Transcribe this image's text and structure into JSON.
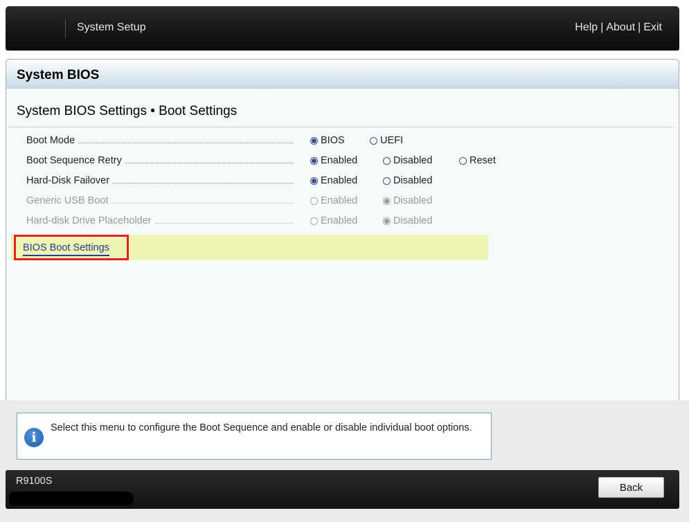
{
  "header": {
    "title": "System Setup",
    "links": [
      "Help",
      "About",
      "Exit"
    ],
    "separator": "|"
  },
  "panel": {
    "title": "System BIOS",
    "breadcrumb": "System BIOS Settings • Boot Settings"
  },
  "settings": [
    {
      "label": "Boot Mode",
      "enabled": true,
      "options": [
        {
          "label": "BIOS",
          "selected": true
        },
        {
          "label": "UEFI",
          "selected": false
        }
      ]
    },
    {
      "label": "Boot Sequence Retry",
      "enabled": true,
      "options": [
        {
          "label": "Enabled",
          "selected": true
        },
        {
          "label": "Disabled",
          "selected": false
        },
        {
          "label": "Reset",
          "selected": false
        }
      ]
    },
    {
      "label": "Hard-Disk Failover",
      "enabled": true,
      "options": [
        {
          "label": "Enabled",
          "selected": true
        },
        {
          "label": "Disabled",
          "selected": false
        }
      ]
    },
    {
      "label": "Generic USB Boot",
      "enabled": false,
      "options": [
        {
          "label": "Enabled",
          "selected": false
        },
        {
          "label": "Disabled",
          "selected": true
        }
      ]
    },
    {
      "label": "Hard-disk Drive Placeholder",
      "enabled": false,
      "options": [
        {
          "label": "Enabled",
          "selected": false
        },
        {
          "label": "Disabled",
          "selected": true
        }
      ]
    }
  ],
  "submenu": {
    "label": "BIOS Boot Settings"
  },
  "help": {
    "text": "Select this menu to configure the Boot Sequence and enable or disable individual boot options."
  },
  "footer": {
    "model": "R9100S",
    "back_label": "Back"
  },
  "colors": {
    "highlight_row": "#eef5b3",
    "selection_border": "#e2202a",
    "link": "#23408f"
  }
}
